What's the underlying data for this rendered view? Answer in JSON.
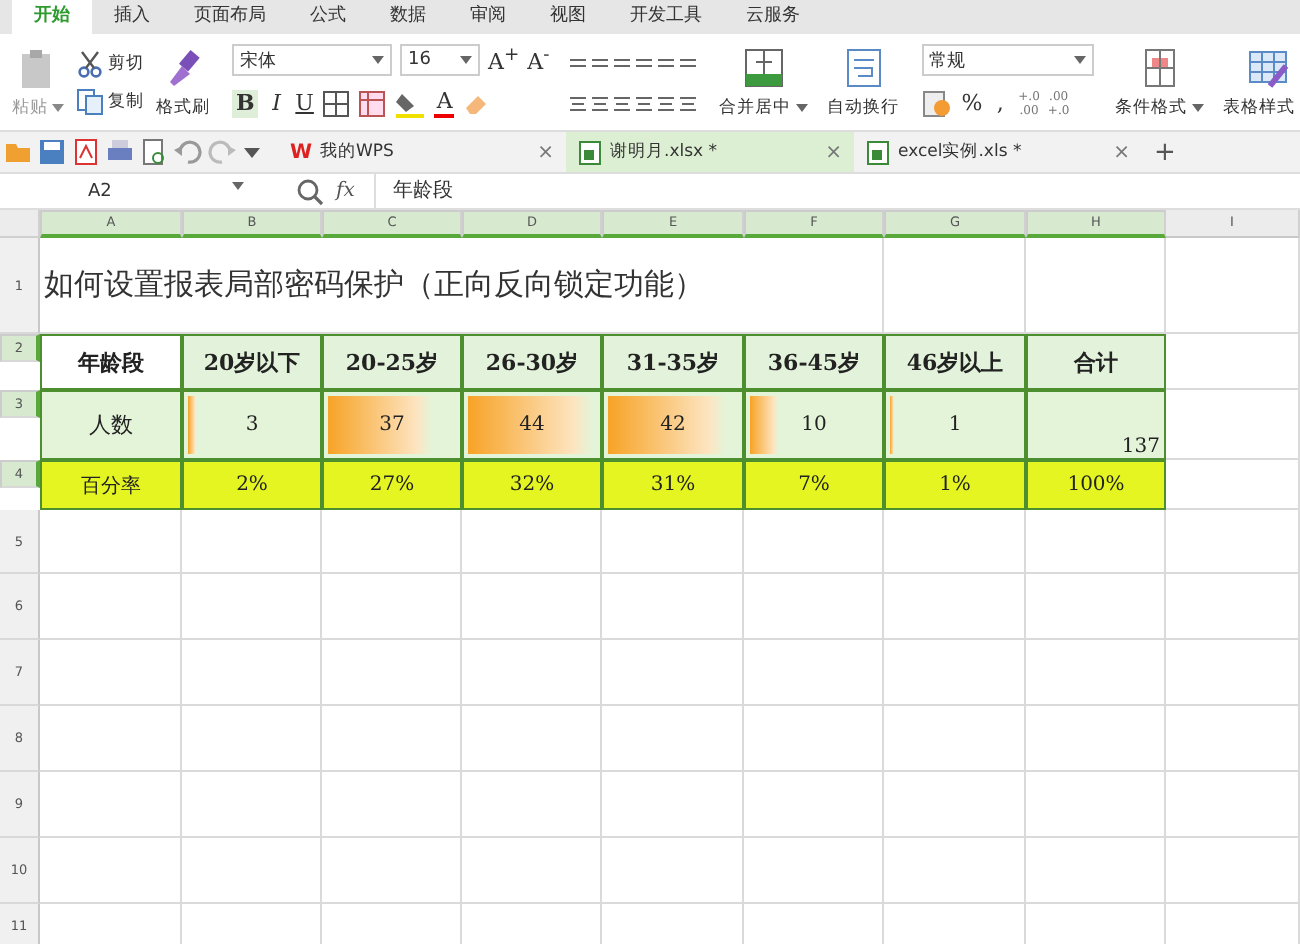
{
  "menu_tabs": [
    {
      "label": "开始",
      "selected": true
    },
    {
      "label": "插入",
      "selected": false
    },
    {
      "label": "页面布局",
      "selected": false
    },
    {
      "label": "公式",
      "selected": false
    },
    {
      "label": "数据",
      "selected": false
    },
    {
      "label": "审阅",
      "selected": false
    },
    {
      "label": "视图",
      "selected": false
    },
    {
      "label": "开发工具",
      "selected": false
    },
    {
      "label": "云服务",
      "selected": false
    }
  ],
  "ribbon": {
    "paste": "粘贴",
    "cut": "剪切",
    "copy": "复制",
    "format_painter": "格式刷",
    "font_name": "宋体",
    "font_size": "16",
    "grow_font": "A$^{+}$",
    "shrink_font": "A$^{-}$",
    "bold": "B",
    "italic": "I",
    "underline": "U",
    "font_color": "A",
    "merge_center": "合并居中",
    "wrap_text": "自动换行",
    "number_format": "常规",
    "percent": "%",
    "comma": ",",
    "decimal_increase": [
      "+.0",
      ".00"
    ],
    "decimal_decrease": [
      ".00",
      "+.0"
    ],
    "conditional_format": "条件格式",
    "table_style": "表格样式"
  },
  "doc_tabs": [
    {
      "label": "我的WPS",
      "logo": "W",
      "selected": false,
      "close": "×"
    },
    {
      "label": "谢明月.xlsx *",
      "selected": true,
      "close": "×"
    },
    {
      "label": "excel实例.xls *",
      "selected": false,
      "close": "×"
    }
  ],
  "new_tab": "+",
  "formula_bar": {
    "cell_ref": "A2",
    "fx": "fx",
    "content": "年龄段"
  },
  "columns": [
    {
      "label": "A",
      "selected": true
    },
    {
      "label": "B",
      "selected": true
    },
    {
      "label": "C",
      "selected": true
    },
    {
      "label": "D",
      "selected": true
    },
    {
      "label": "E",
      "selected": true
    },
    {
      "label": "F",
      "selected": true
    },
    {
      "label": "G",
      "selected": true
    },
    {
      "label": "H",
      "selected": true
    },
    {
      "label": "I",
      "selected": false
    }
  ],
  "row_numbers": [
    {
      "label": "1",
      "selected": false
    },
    {
      "label": "2",
      "selected": true
    },
    {
      "label": "3",
      "selected": true
    },
    {
      "label": "4",
      "selected": true
    },
    {
      "label": "5",
      "selected": false
    },
    {
      "label": "6",
      "selected": false
    },
    {
      "label": "7",
      "selected": false
    },
    {
      "label": "8",
      "selected": false
    },
    {
      "label": "9",
      "selected": false
    },
    {
      "label": "10",
      "selected": false
    },
    {
      "label": "11",
      "selected": false
    }
  ],
  "sheet": {
    "title": "如何设置报表局部密码保护（正向反向锁定功能）",
    "table": [
      {
        "kind": "header",
        "cells": [
          {
            "text": "年龄段"
          },
          {
            "text": "20岁以下"
          },
          {
            "text": "20-25岁"
          },
          {
            "text": "26-30岁"
          },
          {
            "text": "31-35岁"
          },
          {
            "text": "36-45岁"
          },
          {
            "text": "46岁以上"
          },
          {
            "text": "合计"
          }
        ]
      },
      {
        "kind": "bars",
        "cells": [
          {
            "text": "人数"
          },
          {
            "text": "3",
            "level": 0.07
          },
          {
            "text": "37",
            "level": 0.84
          },
          {
            "text": "44",
            "level": 1
          },
          {
            "text": "42",
            "level": 0.95
          },
          {
            "text": "10",
            "level": 0.23
          },
          {
            "text": "1",
            "level": 0.03
          },
          {
            "text": "137"
          }
        ]
      },
      {
        "kind": "percent",
        "cells": [
          {
            "text": "百分率"
          },
          {
            "text": "2%"
          },
          {
            "text": "27%"
          },
          {
            "text": "32%"
          },
          {
            "text": "31%"
          },
          {
            "text": "7%"
          },
          {
            "text": "1%"
          },
          {
            "text": "100%"
          }
        ]
      }
    ]
  }
}
